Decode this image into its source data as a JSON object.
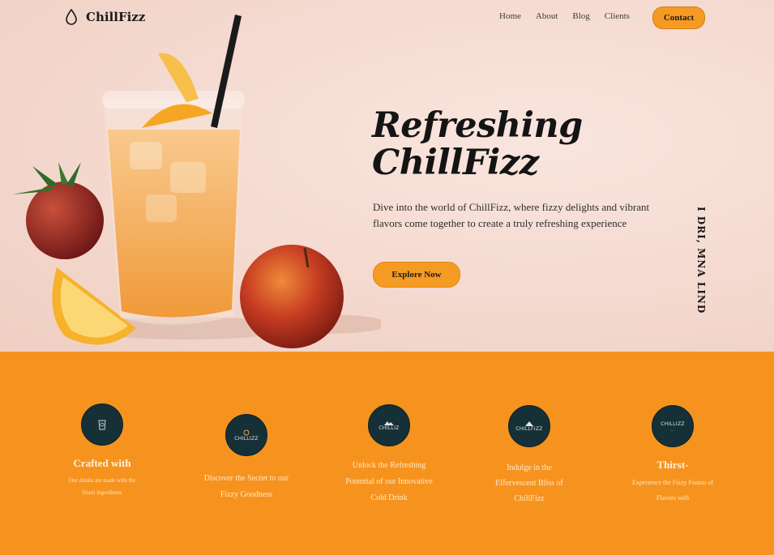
{
  "brand": {
    "name": "ChillFizz",
    "accent": "#f6931f",
    "badge_color": "#153036"
  },
  "nav": {
    "links": [
      "Home",
      "About",
      "Blog",
      "Clients"
    ],
    "contact_label": "Contact"
  },
  "hero": {
    "title_line1": "Refreshing",
    "title_line2": "ChillFizz",
    "description": "Dive into the world of ChillFizz, where fizzy delights and vibrant flavors come together to create a truly refreshing experience",
    "cta_label": "Explore Now",
    "side_text": "I DRI, MNA LIND"
  },
  "features": [
    {
      "icon": "drink-badge-icon",
      "title": "Crafted with",
      "text": "Our drinks are made with the finest ingredients",
      "badge_text": ""
    },
    {
      "icon": "chillizz-badge-icon",
      "title": "",
      "text": "Discover the Secret to our Fizzy Goodness",
      "badge_text": "CHILLIZZ"
    },
    {
      "icon": "chillizz-mountain-badge-icon",
      "title": "",
      "text": "Unlock the Refreshing Potential of our Innovative Cold Drink",
      "badge_text": "CHILLIZ"
    },
    {
      "icon": "chillfizz-mountain-badge-icon",
      "title": "",
      "text": "Indulge in the Effervescent Bliss of ChillFizz",
      "badge_text": "CHILLFIZZ"
    },
    {
      "icon": "chillizz-script-badge-icon",
      "title": "Thirst-",
      "text": "Experience the Fizzy Fusion of Flavors with",
      "badge_text": "CHILLIZZ"
    }
  ]
}
